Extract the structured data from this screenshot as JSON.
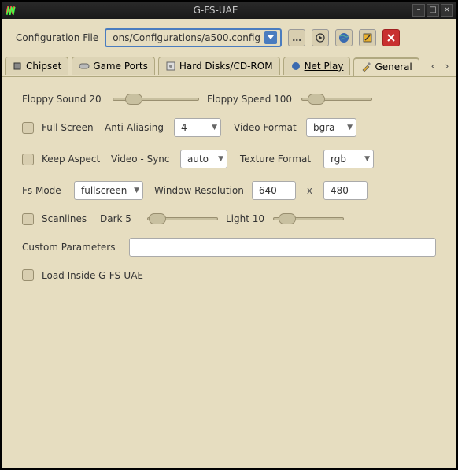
{
  "window": {
    "title": "G-FS-UAE"
  },
  "toolbar": {
    "config_label": "Configuration File",
    "config_value": "ons/Configurations/a500.config"
  },
  "tabs": {
    "chipset": "Chipset",
    "gameports": "Game Ports",
    "harddisks": "Hard Disks/CD-ROM",
    "netplay": "Net Play",
    "general": "General"
  },
  "labels": {
    "floppy_sound": "Floppy Sound 20",
    "floppy_speed": "Floppy Speed 100",
    "full_screen": "Full Screen",
    "anti_aliasing": "Anti-Aliasing",
    "video_format": "Video Format",
    "keep_aspect": "Keep Aspect",
    "video_sync": "Video - Sync",
    "texture_format": "Texture Format",
    "fs_mode": "Fs Mode",
    "window_resolution": "Window Resolution",
    "x": "x",
    "scanlines": "Scanlines",
    "dark": "Dark 5",
    "light": "Light 10",
    "custom_params": "Custom Parameters",
    "load_inside": "Load Inside G-FS-UAE"
  },
  "values": {
    "anti_aliasing": "4",
    "video_format": "bgra",
    "video_sync": "auto",
    "texture_format": "rgb",
    "fs_mode": "fullscreen",
    "res_w": "640",
    "res_h": "480",
    "custom_params": ""
  }
}
